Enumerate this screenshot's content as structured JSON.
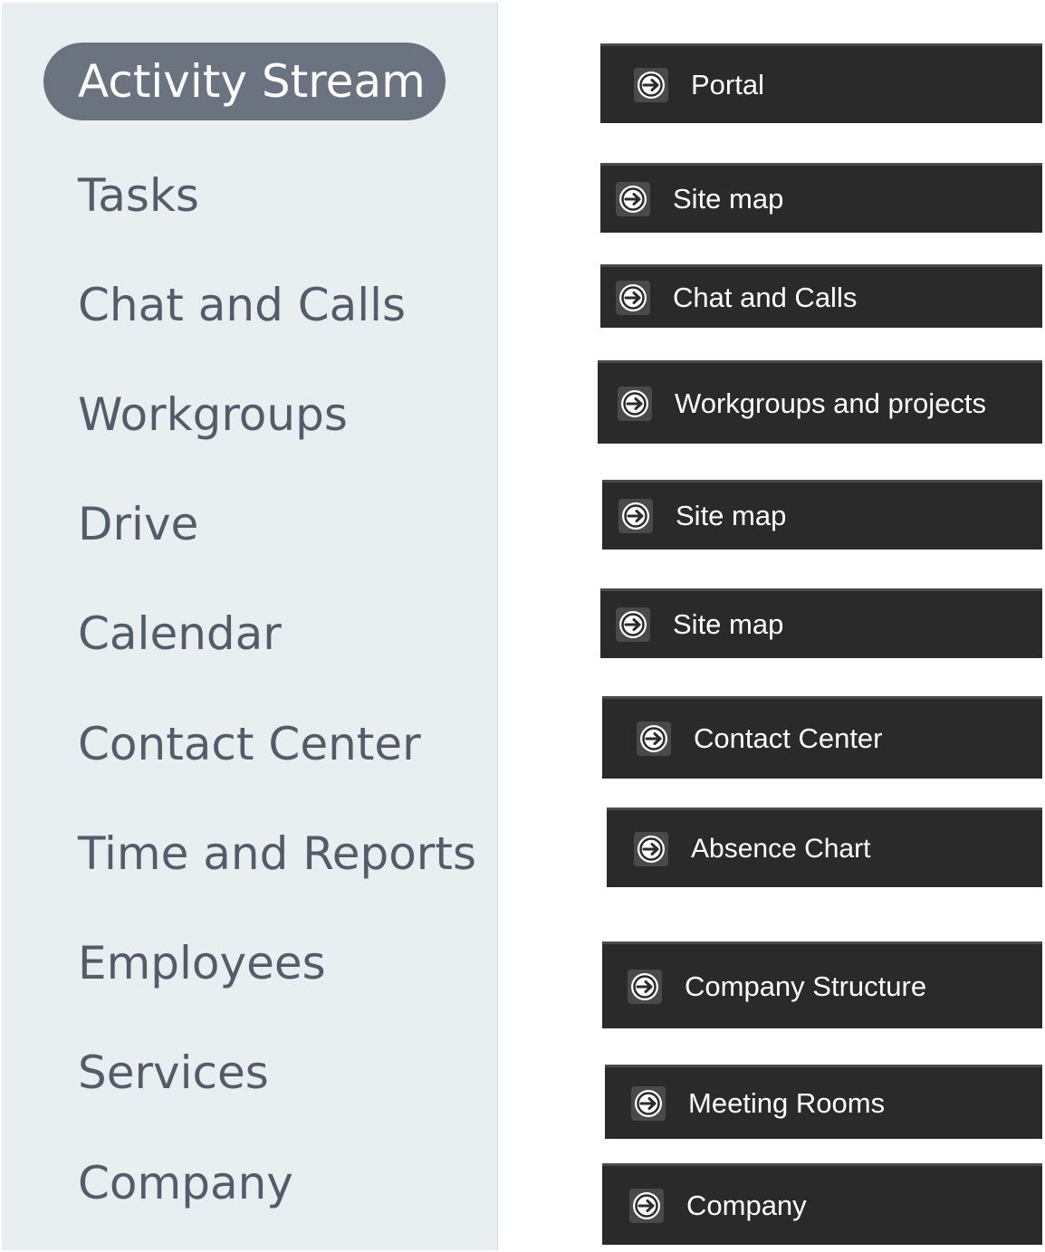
{
  "sidebar": {
    "items": [
      {
        "label": "Activity Stream",
        "active": true
      },
      {
        "label": "Tasks"
      },
      {
        "label": "Chat and Calls"
      },
      {
        "label": "Workgroups"
      },
      {
        "label": "Drive"
      },
      {
        "label": "Calendar"
      },
      {
        "label": "Contact Center"
      },
      {
        "label": "Time and Reports"
      },
      {
        "label": "Employees"
      },
      {
        "label": "Services"
      },
      {
        "label": "Company"
      }
    ]
  },
  "links": {
    "icon": "arrow-circle-icon",
    "items": [
      {
        "label": "Portal"
      },
      {
        "label": "Site map"
      },
      {
        "label": "Chat and Calls"
      },
      {
        "label": "Workgroups and projects"
      },
      {
        "label": "Site map"
      },
      {
        "label": "Site map"
      },
      {
        "label": "Contact Center"
      },
      {
        "label": "Absence Chart"
      },
      {
        "label": "Company Structure"
      },
      {
        "label": "Meeting Rooms"
      },
      {
        "label": "Company"
      }
    ]
  },
  "colors": {
    "sidebar_bg": "#e9eff0",
    "sidebar_text": "#535c69",
    "active_pill": "#6b7280",
    "link_bg": "#2a2a2a",
    "link_text": "#ffffff"
  }
}
